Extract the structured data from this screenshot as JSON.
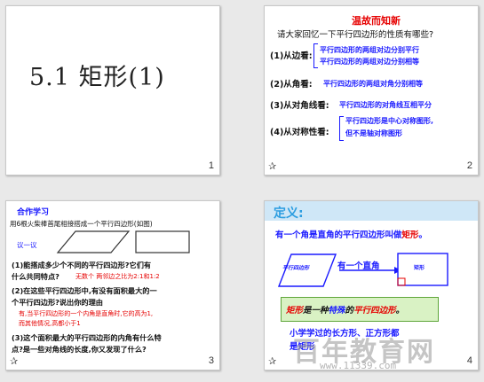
{
  "slides": {
    "s1": {
      "title": "5.1 矩形(1)",
      "num": "1"
    },
    "s2": {
      "num": "2",
      "heading": "温故而知新",
      "question": "请大家回忆一下平行四边形的性质有哪些?",
      "edge_label": "(1)从边看:",
      "edge_1": "平行四边形的两组对边分别平行",
      "edge_2": "平行四边形的两组对边分别相等",
      "angle_label": "(2)从角看:",
      "angle_1": "平行四边形的两组对角分别相等",
      "diag_label": "(3)从对角线看:",
      "diag_1": "平行四边形的对角线互相平分",
      "sym_label": "(4)从对称性看:",
      "sym_1": "平行四边形是中心对称图形,",
      "sym_2": "但不是轴对称图形"
    },
    "s3": {
      "num": "3",
      "heading": "合作学习",
      "intro": "用6根火柴棒首尾相接搭成一个平行四边形(如图)",
      "try_label": "议一议",
      "q1": "(1)能搭成多少个不同的平行四边形?它们有",
      "q1b": "什么共同特点?",
      "a1": "无数个  两邻边之比为2:1和1:2",
      "q2": "(2)在这些平行四边形中,有没有面积最大的一",
      "q2b": "个平行四边形?说出你的理由",
      "a2": "有,当平行四边形的一个内角是直角时,它的高为1,",
      "a2b": "而其他情况,高都小于1",
      "q3": "(3)这个面积最大的平行四边形的内角有什么特",
      "q3b": "点?是一些对角线的长度,你又发现了什么?"
    },
    "s4": {
      "num": "4",
      "heading": "定义:",
      "definition_pre": "有一个角是直角的平行四边形叫做",
      "definition_key": "矩形",
      "definition_end": "。",
      "para_label": "平行四边形",
      "arrow_text": "有一个直角",
      "rect_label": "矩形",
      "special_1": "矩形",
      "special_2": "是一种",
      "special_3": "特殊",
      "special_4": "的",
      "special_5": "平行四边形",
      "special_6": "。",
      "note_1": "小学学过的长方形、正方形都",
      "note_2": "是矩形"
    }
  },
  "watermark": {
    "text": "百年教育网",
    "url": "www.11339.com"
  },
  "colors": {
    "red": "#e60000",
    "blue": "#1a1aff",
    "green_box": "#d9f2c4",
    "s4_header": "#cfe7f7"
  }
}
